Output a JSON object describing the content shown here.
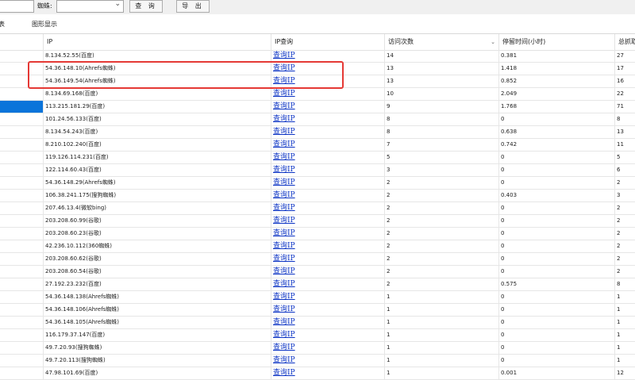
{
  "toolbar": {
    "spider_label": "蜘蛛:",
    "spider_select_value": "",
    "query_label": "查 询",
    "export_label": "导 出"
  },
  "tabs": [
    {
      "label": "表"
    },
    {
      "label": "图形显示"
    }
  ],
  "table": {
    "headers": [
      "",
      "IP",
      "IP查询",
      "访问次数",
      "停留时间(小时)",
      "总抓取"
    ],
    "rows": [
      {
        "ip": "8.134.52.55(百度)",
        "lookup": "查询IP",
        "visits": "14",
        "stay": "0.381",
        "total": "27"
      },
      {
        "ip": "54.36.148.10(Ahrefs蜘蛛)",
        "lookup": "查询IP",
        "visits": "13",
        "stay": "1.418",
        "total": "17"
      },
      {
        "ip": "54.36.149.54(Ahrefs蜘蛛)",
        "lookup": "查询IP",
        "visits": "13",
        "stay": "0.852",
        "total": "16"
      },
      {
        "ip": "8.134.69.168(百度)",
        "lookup": "查询IP",
        "visits": "10",
        "stay": "2.049",
        "total": "22"
      },
      {
        "ip": "113.215.181.29(百度)",
        "lookup": "查询IP",
        "visits": "9",
        "stay": "1.768",
        "total": "71"
      },
      {
        "ip": "101.24.56.133(百度)",
        "lookup": "查询IP",
        "visits": "8",
        "stay": "0",
        "total": "8"
      },
      {
        "ip": "8.134.54.243(百度)",
        "lookup": "查询IP",
        "visits": "8",
        "stay": "0.638",
        "total": "13"
      },
      {
        "ip": "8.210.102.240(百度)",
        "lookup": "查询IP",
        "visits": "7",
        "stay": "0.742",
        "total": "11"
      },
      {
        "ip": "119.126.114.231(百度)",
        "lookup": "查询IP",
        "visits": "5",
        "stay": "0",
        "total": "5"
      },
      {
        "ip": "122.114.60.43(百度)",
        "lookup": "查询IP",
        "visits": "3",
        "stay": "0",
        "total": "6"
      },
      {
        "ip": "54.36.148.29(Ahrefs蜘蛛)",
        "lookup": "查询IP",
        "visits": "2",
        "stay": "0",
        "total": "2"
      },
      {
        "ip": "106.38.241.175(搜狗蜘蛛)",
        "lookup": "查询IP",
        "visits": "2",
        "stay": "0.403",
        "total": "3"
      },
      {
        "ip": "207.46.13.4(微软bing)",
        "lookup": "查询IP",
        "visits": "2",
        "stay": "0",
        "total": "2"
      },
      {
        "ip": "203.208.60.99(谷歌)",
        "lookup": "查询IP",
        "visits": "2",
        "stay": "0",
        "total": "2"
      },
      {
        "ip": "203.208.60.23(谷歌)",
        "lookup": "查询IP",
        "visits": "2",
        "stay": "0",
        "total": "2"
      },
      {
        "ip": "42.236.10.112(360蜘蛛)",
        "lookup": "查询IP",
        "visits": "2",
        "stay": "0",
        "total": "2"
      },
      {
        "ip": "203.208.60.62(谷歌)",
        "lookup": "查询IP",
        "visits": "2",
        "stay": "0",
        "total": "2"
      },
      {
        "ip": "203.208.60.54(谷歌)",
        "lookup": "查询IP",
        "visits": "2",
        "stay": "0",
        "total": "2"
      },
      {
        "ip": "27.192.23.232(百度)",
        "lookup": "查询IP",
        "visits": "2",
        "stay": "0.575",
        "total": "8"
      },
      {
        "ip": "54.36.148.138(Ahrefs蜘蛛)",
        "lookup": "查询IP",
        "visits": "1",
        "stay": "0",
        "total": "1"
      },
      {
        "ip": "54.36.148.106(Ahrefs蜘蛛)",
        "lookup": "查询IP",
        "visits": "1",
        "stay": "0",
        "total": "1"
      },
      {
        "ip": "54.36.148.105(Ahrefs蜘蛛)",
        "lookup": "查询IP",
        "visits": "1",
        "stay": "0",
        "total": "1"
      },
      {
        "ip": "116.179.37.147(百度)",
        "lookup": "查询IP",
        "visits": "1",
        "stay": "0",
        "total": "1"
      },
      {
        "ip": "49.7.20.93(搜狗蜘蛛)",
        "lookup": "查询IP",
        "visits": "1",
        "stay": "0",
        "total": "1"
      },
      {
        "ip": "49.7.20.113(搜狗蜘蛛)",
        "lookup": "查询IP",
        "visits": "1",
        "stay": "0",
        "total": "1"
      },
      {
        "ip": "47.98.101.69(百度)",
        "lookup": "查询IP",
        "visits": "1",
        "stay": "0.001",
        "total": "12"
      }
    ],
    "selected_row_index": 4
  },
  "colors": {
    "link": "#0b33c4",
    "selection": "#0a74da",
    "highlight_box": "#e53935"
  }
}
